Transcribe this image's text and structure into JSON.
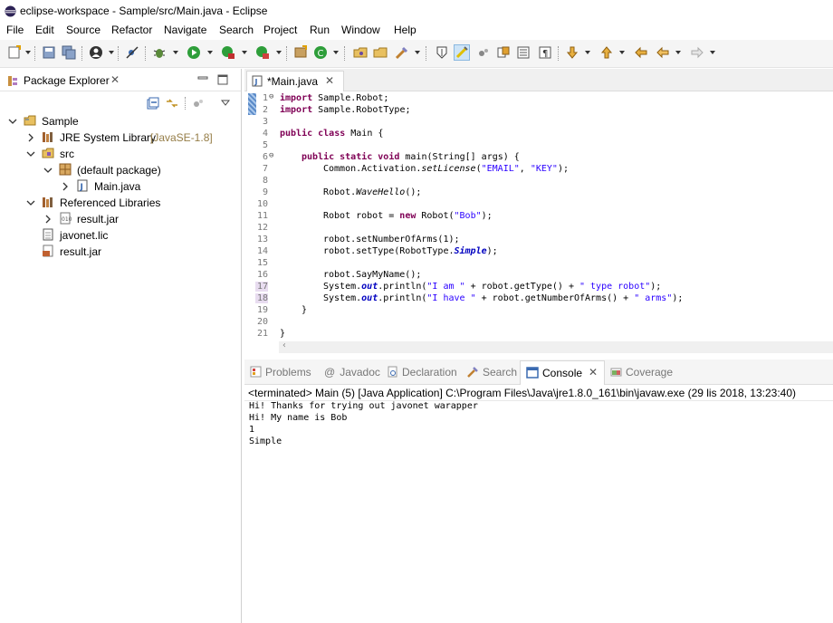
{
  "window": {
    "title": "eclipse-workspace - Sample/src/Main.java - Eclipse"
  },
  "menu": [
    "File",
    "Edit",
    "Source",
    "Refactor",
    "Navigate",
    "Search",
    "Project",
    "Run",
    "Window",
    "Help"
  ],
  "toolbar": {
    "icons": [
      "new-icon",
      "save-icon",
      "save-all-icon",
      "account-icon",
      "skip-breakpoints-icon",
      "debug-icon",
      "run-icon",
      "coverage-icon",
      "external-tools-icon",
      "new-java-project-icon",
      "new-class-icon",
      "open-type-icon",
      "open-folder-icon",
      "search-icon",
      "toggle-mark-occurrences-icon",
      "toggle-highlight-icon",
      "block-selection-icon",
      "toggle-word-wrap-icon",
      "show-whitespace-icon",
      "next-annotation-icon",
      "previous-annotation-icon",
      "last-edit-icon",
      "back-icon",
      "forward-icon"
    ]
  },
  "package_explorer": {
    "tab_label": "Package Explorer",
    "tree": [
      {
        "label": "Sample",
        "icon": "project-icon",
        "expanded": true
      },
      {
        "label": "JRE System Library",
        "suffix": "[JavaSE-1.8]",
        "icon": "library-icon",
        "expanded": false
      },
      {
        "label": "src",
        "icon": "source-folder-icon",
        "expanded": true
      },
      {
        "label": "(default package)",
        "icon": "package-icon",
        "expanded": true
      },
      {
        "label": "Main.java",
        "icon": "java-file-icon",
        "expanded": false
      },
      {
        "label": "Referenced Libraries",
        "icon": "library-icon",
        "expanded": true
      },
      {
        "label": "result.jar",
        "icon": "jar-icon",
        "expanded": false
      },
      {
        "label": "javonet.lic",
        "icon": "file-icon"
      },
      {
        "label": "result.jar",
        "icon": "jar-icon"
      }
    ]
  },
  "editor": {
    "tab_label": "*Main.java",
    "line_numbers": [
      "1",
      "2",
      "3",
      "4",
      "5",
      "6",
      "7",
      "8",
      "9",
      "10",
      "11",
      "12",
      "13",
      "14",
      "15",
      "16",
      "17",
      "18",
      "19",
      "20",
      "21"
    ],
    "code": {
      "l1_kw": "import",
      "l1_rest": " Sample.Robot;",
      "l2_kw": "import",
      "l2_rest": " Sample.RobotType;",
      "l4_kw": "public class",
      "l4_rest": " Main {",
      "l6_kw": "public static void",
      "l6_rest": " main(String[] args) {",
      "l7_a": "Common.Activation.",
      "l7_m": "setLicense",
      "l7_b": "(",
      "l7_s1": "\"EMAIL\"",
      "l7_c": ", ",
      "l7_s2": "\"KEY\"",
      "l7_d": ");",
      "l9_a": "Robot.",
      "l9_m": "WaveHello",
      "l9_b": "();",
      "l11_a": "Robot robot = ",
      "l11_kw": "new",
      "l11_b": " Robot(",
      "l11_s": "\"Bob\"",
      "l11_c": ");",
      "l13": "robot.setNumberOfArms(1);",
      "l14_a": "robot.setType(RobotType.",
      "l14_f": "Simple",
      "l14_b": ");",
      "l16": "robot.SayMyName();",
      "l17_a": "System.",
      "l17_f": "out",
      "l17_b": ".println(",
      "l17_s1": "\"I am \"",
      "l17_c": " + robot.getType() + ",
      "l17_s2": "\" type robot\"",
      "l17_d": ");",
      "l18_a": "System.",
      "l18_f": "out",
      "l18_b": ".println(",
      "l18_s1": "\"I have \"",
      "l18_c": " + robot.getNumberOfArms() + ",
      "l18_s2": "\" arms\"",
      "l18_d": ");",
      "l19": "}",
      "l21": "}"
    }
  },
  "bottom_panel": {
    "tabs": [
      "Problems",
      "Javadoc",
      "Declaration",
      "Search",
      "Console",
      "Coverage"
    ],
    "active_tab": "Console",
    "console_header": "<terminated> Main (5) [Java Application] C:\\Program Files\\Java\\jre1.8.0_161\\bin\\javaw.exe (29 lis 2018, 13:23:40)",
    "output": [
      "Hi! Thanks for trying out javonet warapper",
      "Hi! My name is Bob",
      "1",
      "Simple"
    ]
  }
}
